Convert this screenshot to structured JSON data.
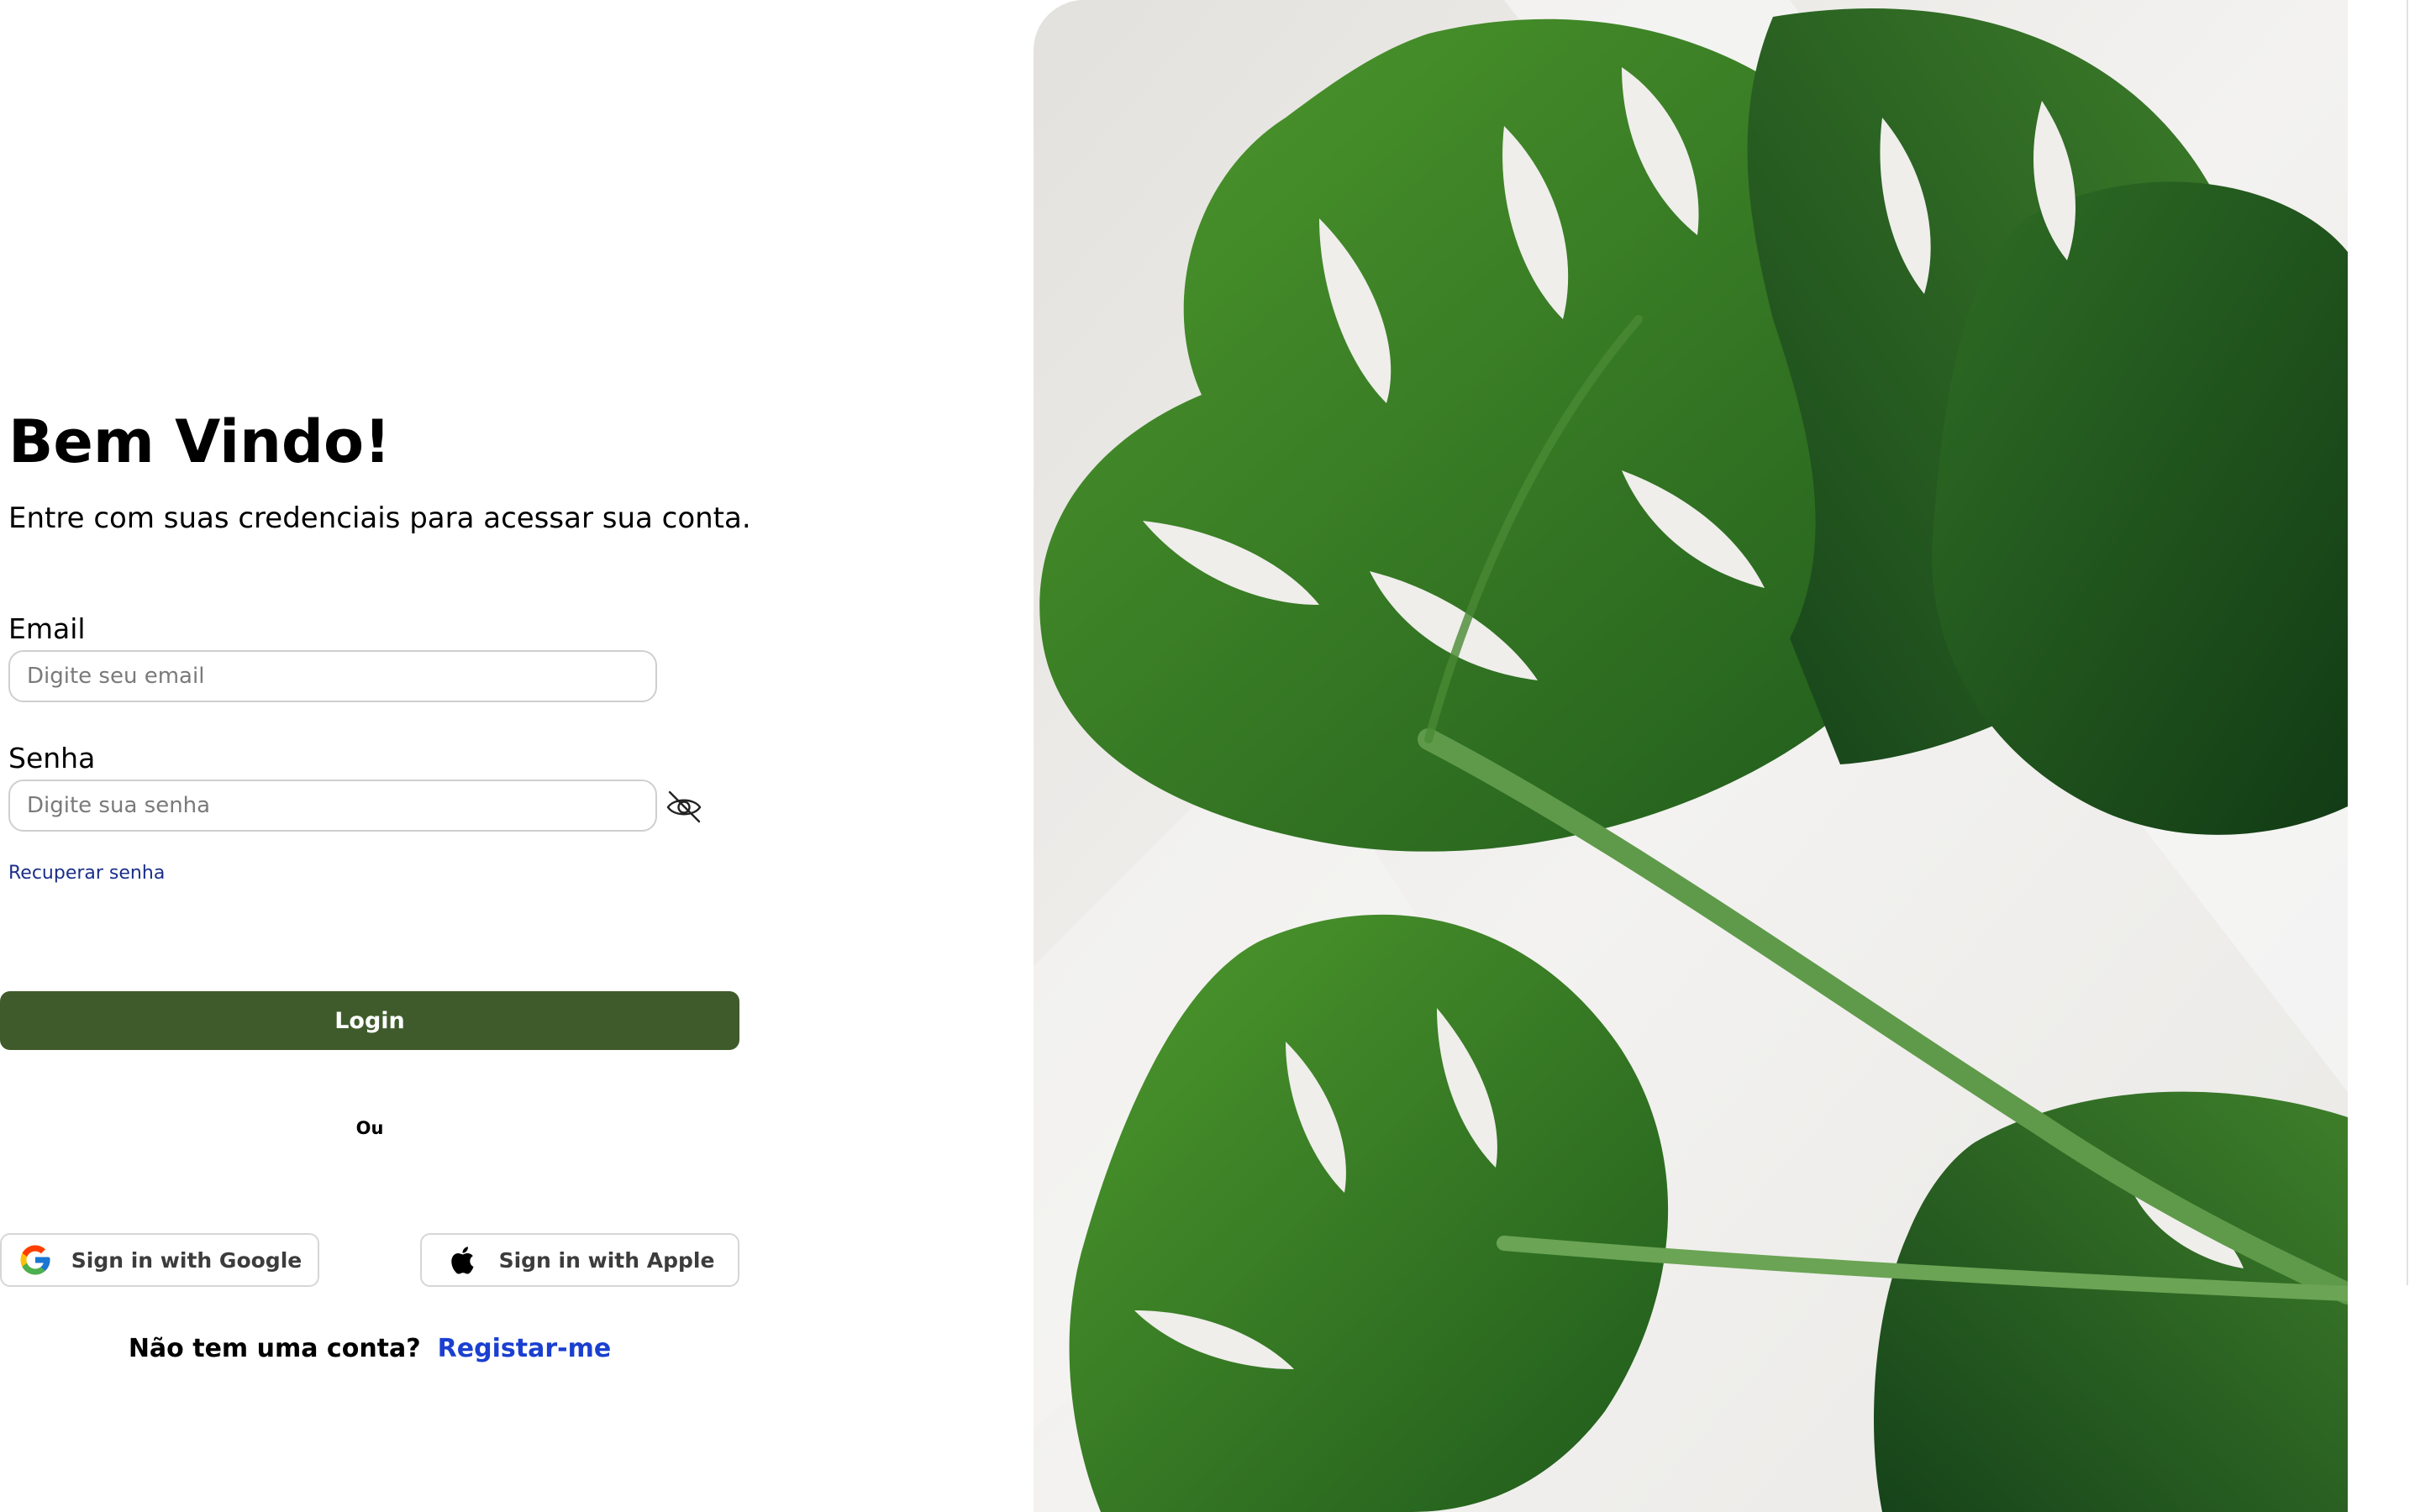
{
  "login": {
    "title": "Bem Vindo!",
    "subtitle": "Entre com suas credenciais para acessar sua conta.",
    "email_label": "Email",
    "email_placeholder": "Digite seu email",
    "password_label": "Senha",
    "password_placeholder": "Digite sua senha",
    "toggle_icon": "eye-slash-icon",
    "recover_label": "Recuperar senha",
    "login_label": "Login",
    "or_label": "Ou",
    "google_label": "Sign in with Google",
    "apple_label": "Sign in with Apple",
    "no_account_text": "Não tem uma conta?",
    "register_label": "Registar-me"
  },
  "hero": {
    "image": "monstera-leaves-photo"
  },
  "colors": {
    "primary_button": "#3f5b2b",
    "link": "#1a3fd1",
    "recover_link": "#1b2f8a"
  }
}
